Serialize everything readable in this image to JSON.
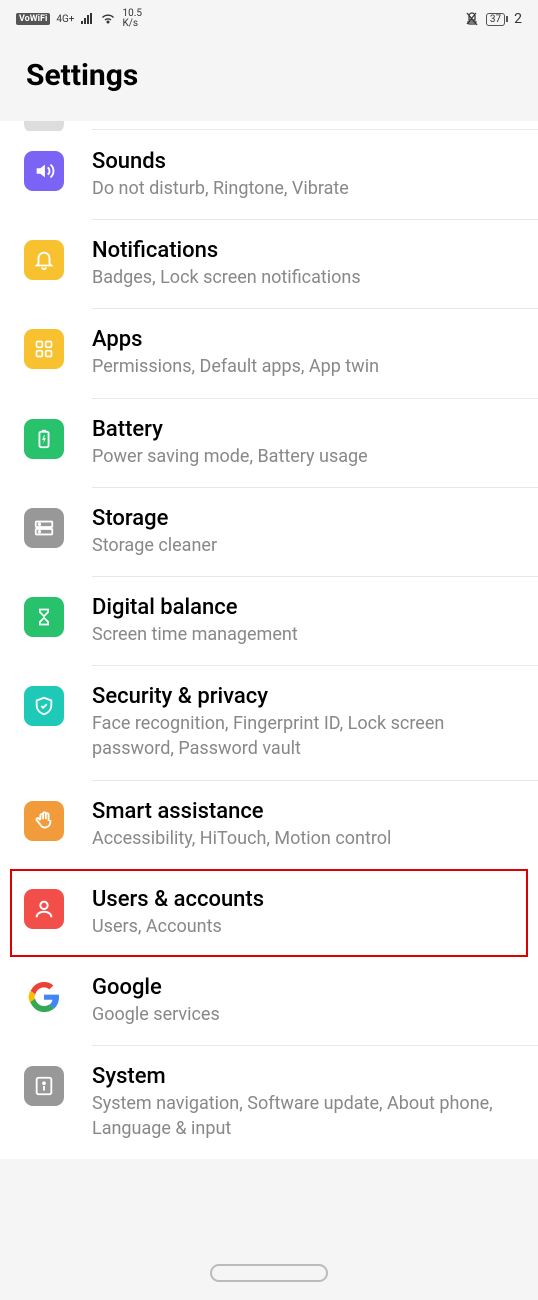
{
  "status": {
    "vowifi": "VoWiFi",
    "network": "4G+",
    "speed_top": "10.5",
    "speed_bot": "K/s",
    "battery": "37",
    "clock_part": "2"
  },
  "header": {
    "title": "Settings"
  },
  "items": [
    {
      "title": "Sounds",
      "subtitle": "Do not disturb, Ringtone, Vibrate"
    },
    {
      "title": "Notifications",
      "subtitle": "Badges, Lock screen notifications"
    },
    {
      "title": "Apps",
      "subtitle": "Permissions, Default apps, App twin"
    },
    {
      "title": "Battery",
      "subtitle": "Power saving mode, Battery usage"
    },
    {
      "title": "Storage",
      "subtitle": "Storage cleaner"
    },
    {
      "title": "Digital balance",
      "subtitle": "Screen time management"
    },
    {
      "title": "Security & privacy",
      "subtitle": "Face recognition, Fingerprint ID, Lock screen password, Password vault"
    },
    {
      "title": "Smart assistance",
      "subtitle": "Accessibility, HiTouch, Motion control"
    },
    {
      "title": "Users & accounts",
      "subtitle": "Users, Accounts"
    },
    {
      "title": "Google",
      "subtitle": "Google services"
    },
    {
      "title": "System",
      "subtitle": "System navigation, Software update, About phone, Language & input"
    }
  ]
}
